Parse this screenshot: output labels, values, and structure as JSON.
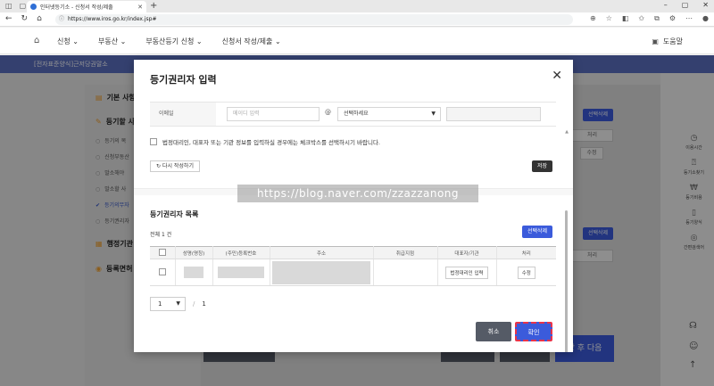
{
  "browser": {
    "tab_title": "인터넷등기소 - 신청서 작성/제출",
    "url": "https://www.iros.go.kr/index.jsp#"
  },
  "site": {
    "menu": [
      "신청",
      "부동산",
      "부동산등기 신청",
      "신청서 작성/제출"
    ],
    "help": "도움말",
    "breadcrumb": "[전자표준양식]근저당권말소"
  },
  "left_menu": {
    "sections": [
      {
        "label": "기본 사항"
      },
      {
        "label": "등기할 사항"
      },
      {
        "label": "행정기관"
      },
      {
        "label": "등록면허"
      }
    ],
    "items": [
      "등기의 목",
      "신청부동산",
      "말소해야",
      "말소할 사",
      "등기의무자",
      "등기권리자"
    ]
  },
  "background": {
    "sel_delete": "선택삭제",
    "col_process": "처리",
    "edit": "수정",
    "next": "장 후 다음"
  },
  "right_rail": [
    "이용시간",
    "등기소찾기",
    "등기비용",
    "등기양식",
    "간편검색어"
  ],
  "modal": {
    "title": "등기권리자 입력",
    "email_label": "이메일",
    "email_placeholder": "메이디 입력",
    "at": "@",
    "domain_select": "선택하세요",
    "checkbox_text": "법정대리인, 대표자 또는 기관 정보를 입력하실 경우에는 체크박스를 선택하시기 바랍니다.",
    "rewrite": "다시 작성하기",
    "save": "저장",
    "watermark": "https://blog.naver.com/zzazzanong",
    "list_title": "등기권리자 목록",
    "total": "전체 1 건",
    "sel_delete": "선택삭제",
    "columns": [
      "",
      "성명(명칭)",
      "(주민)등록번호",
      "주소",
      "취급지점",
      "대표자/기관",
      "처리"
    ],
    "row": {
      "rep_btn": "법정대리인 입력",
      "edit": "수정"
    },
    "pager": {
      "page": "1",
      "total": "1"
    },
    "cancel": "취소",
    "confirm": "확인"
  }
}
